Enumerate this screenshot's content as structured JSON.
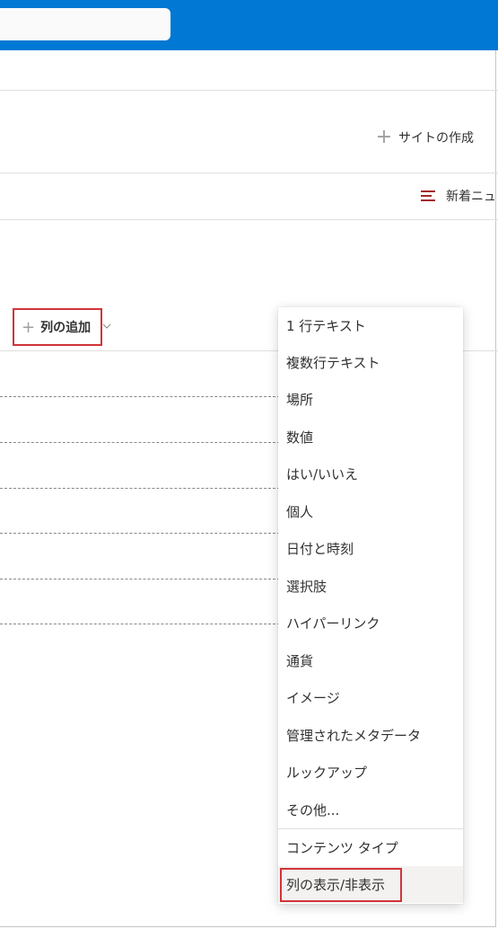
{
  "search": {
    "placeholder": ""
  },
  "commands": {
    "create_site": "サイトの作成",
    "news": "新着ニュ"
  },
  "list": {
    "add_column_label": "列の追加"
  },
  "column_menu": {
    "items": [
      "1 行テキスト",
      "複数行テキスト",
      "場所",
      "数値",
      "はい/いいえ",
      "個人",
      "日付と時刻",
      "選択肢",
      "ハイパーリンク",
      "通貨",
      "イメージ",
      "管理されたメタデータ",
      "ルックアップ",
      "その他..."
    ],
    "content_type": "コンテンツ タイプ",
    "show_hide": "列の表示/非表示"
  },
  "colors": {
    "topbar": "#0078d4",
    "highlight": "#d13438",
    "news_icon": "#a4262c"
  }
}
